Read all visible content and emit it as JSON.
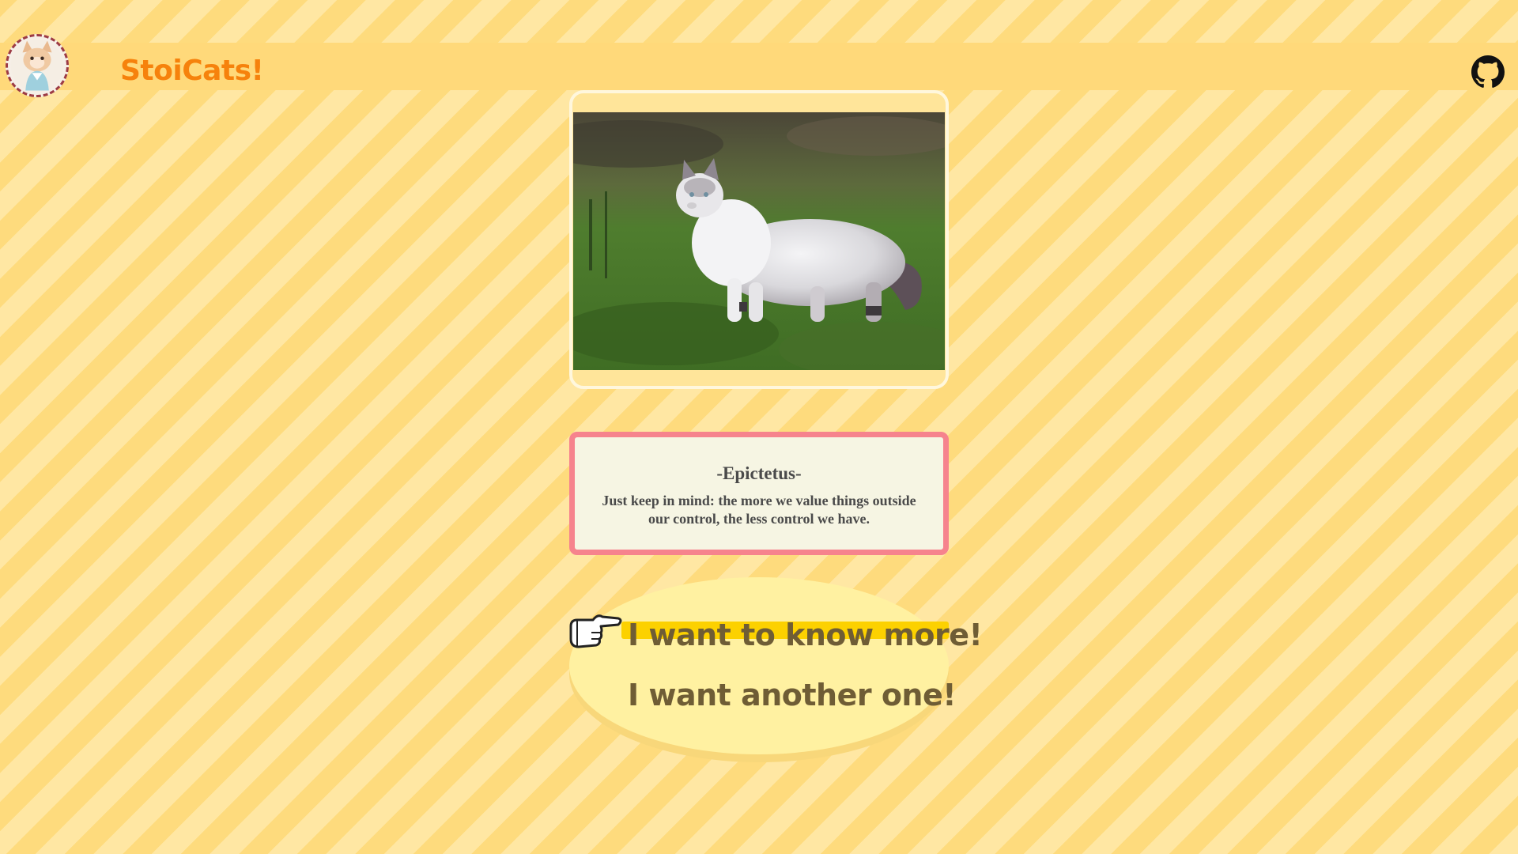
{
  "header": {
    "title": "StoiCats!",
    "logo_icon": "cat-avatar-logo-icon",
    "github_icon": "github-icon"
  },
  "photo": {
    "subject_icon": "cat-photo"
  },
  "quote": {
    "author": "-Epictetus-",
    "text": "Just keep in mind: the more we value things outside our control, the less control we have."
  },
  "choices": {
    "pointer_icon": "pointing-hand-icon",
    "items": [
      {
        "label": "I want to know more!",
        "selected": true
      },
      {
        "label": "I want another one!",
        "selected": false
      }
    ]
  },
  "colors": {
    "title": "#f6820c",
    "header_bar": "#ffd97a",
    "quote_border": "#f6838d",
    "choice_highlight": "#fcd100",
    "choice_text": "#6f5d35"
  }
}
